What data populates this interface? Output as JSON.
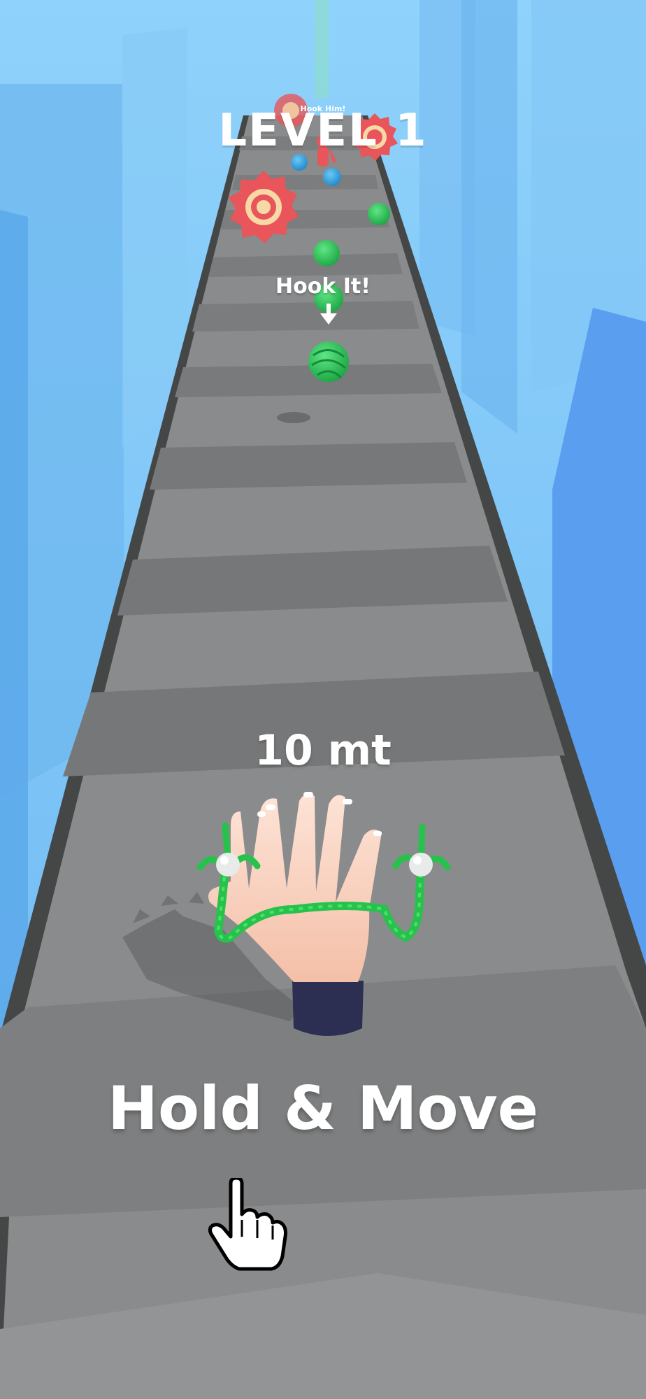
{
  "hud": {
    "level_title": "LEVEL 1",
    "far_hint": "Hook Him!",
    "hook_hint": "Hook It!",
    "distance": "10 mt",
    "instruction": "Hold & Move"
  },
  "icons": {
    "hook_arrow": "down-arrow-icon",
    "pointer": "tap-hand-icon"
  },
  "colors": {
    "sky": "#79c4f6",
    "track": "#8a8a8a",
    "rope": "#27c24c",
    "saw": "#e8555a",
    "yarn_green": "#2ecc5a",
    "yarn_blue": "#2ea8ea",
    "hand": "#fcd9c8",
    "sleeve": "#2c2f52"
  }
}
